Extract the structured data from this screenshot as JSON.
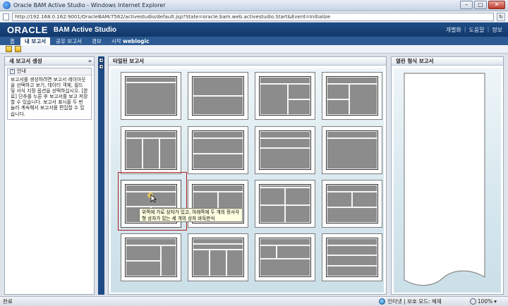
{
  "window": {
    "title": "Oracle BAM Active Studio - Windows Internet Explorer",
    "url": "http://192.168.0.162:9001/OracleBAM/7562/activestudio/default.jsp?State=oracle.bam.web.activestudio.Start&Event=Initialize",
    "minimize": "–",
    "maximize": "□",
    "close": "✕",
    "go_glyph": "↻"
  },
  "header": {
    "logo": "ORACLE",
    "product": "BAM Active Studio",
    "links": [
      "개별화",
      "도움말",
      "정보"
    ],
    "link_separator": "|"
  },
  "tabs": [
    {
      "label": "홈",
      "active": false
    },
    {
      "label": "내 보고서",
      "active": true
    },
    {
      "label": "공유 보고서",
      "active": false
    },
    {
      "label": "경보",
      "active": false
    },
    {
      "label": "시작",
      "active": false,
      "suffix": "weblogic"
    }
  ],
  "left_panel": {
    "title": "새 보고서 생성",
    "collapse": "»",
    "guide_title": "안내",
    "guide_icon": "i",
    "guide_text": "보고서를 생성하려면 보고서 레이아웃을 선택하고 보기, 데이터 객체, 필드 및 서식 지정 옵션을 선택하십시오. [완료] 단추를 누른 후 보고서를 보고 저장할 수 있습니다. 보고서 표시줄 두 번 눌러 계속해서 보고서를 편집할 수 있습니다."
  },
  "splitter": {
    "top_btn": "◂",
    "second_btn": "◂"
  },
  "center_panel": {
    "title": "타일된 보고서",
    "tooltip": "위쪽에 가로 상자가 있고, 아래쪽에 두 개의 정사각형 상자가 있는 세 개의 상자 바둑판식"
  },
  "right_panel": {
    "title": "열린 형식 보고서"
  },
  "status": {
    "left": "완료",
    "zone": "인터넷 | 보호 모드: 해제",
    "zoom": "100%",
    "zoom_arrow": "▾"
  }
}
